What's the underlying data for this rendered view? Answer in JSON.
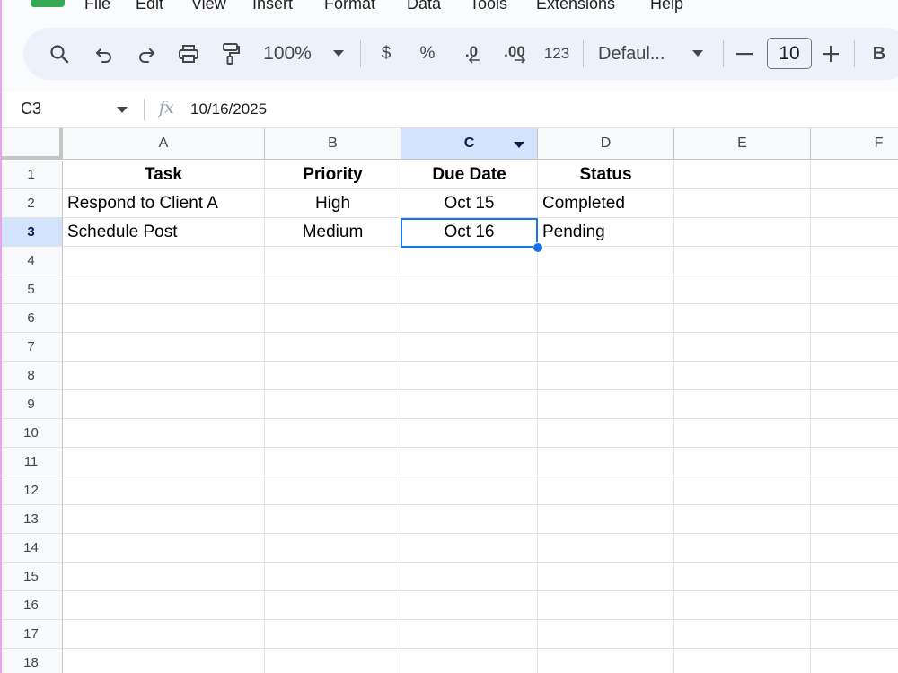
{
  "menu": {
    "items": [
      "File",
      "Edit",
      "View",
      "Insert",
      "Format",
      "Data",
      "Tools",
      "Extensions",
      "Help"
    ]
  },
  "toolbar": {
    "zoom": "100%",
    "currency": "$",
    "percent": "%",
    "decrease_decimal": ".0",
    "increase_decimal": ".00",
    "number_format": "123",
    "font": "Defaul...",
    "font_size": "10",
    "bold": "B"
  },
  "formula_bar": {
    "name_box": "C3",
    "fx": "fx",
    "value": "10/16/2025"
  },
  "sheet": {
    "columns": [
      "A",
      "B",
      "C",
      "D",
      "E",
      "F"
    ],
    "rows": [
      "1",
      "2",
      "3",
      "4",
      "5",
      "6",
      "7",
      "8",
      "9",
      "10",
      "11",
      "12",
      "13",
      "14",
      "15",
      "16",
      "17",
      "18"
    ],
    "selected_cell": "C3",
    "cells": {
      "A1": "Task",
      "B1": "Priority",
      "C1": "Due Date",
      "D1": "Status",
      "A2": "Respond to Client A",
      "B2": "High",
      "C2": "Oct 15",
      "D2": "Completed",
      "A3": "Schedule Post",
      "B3": "Medium",
      "C3": "Oct 16",
      "D3": "Pending"
    }
  },
  "colors": {
    "selection": "#1a73e8",
    "active_header": "#d3e3fd",
    "toolbar_bg": "#edf2fa",
    "logo": "#34a853"
  }
}
